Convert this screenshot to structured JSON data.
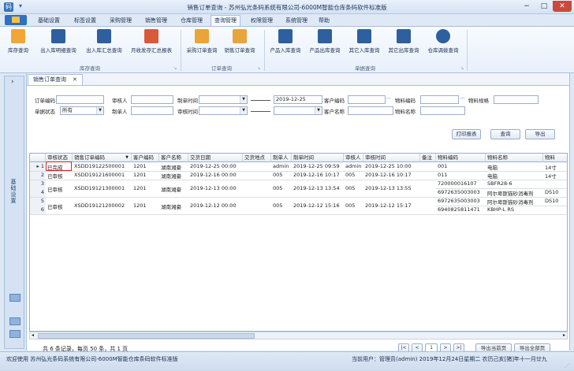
{
  "window": {
    "title": "销售订单查询 - 苏州弘光条码系统有限公司-6000M智能仓库条码软件标准版",
    "min_icon": "−",
    "max_icon": "□",
    "close_icon": "✕"
  },
  "menu": {
    "tabs": [
      "基础设置",
      "标签设置",
      "采购管理",
      "销售管理",
      "仓库管理",
      "查询管理",
      "权限管理",
      "系统管理",
      "帮助"
    ],
    "active_index": 5
  },
  "ribbon": {
    "groups": [
      {
        "label": "库存查询",
        "buttons": [
          "库存查询",
          "出入库明细查询",
          "出入库汇总查询",
          "月收发存汇总报表"
        ]
      },
      {
        "label": "订单查询",
        "buttons": [
          "采购订单查询",
          "销售订单查询"
        ]
      },
      {
        "label": "单据查询",
        "buttons": [
          "产品入库查询",
          "产品出库查询",
          "其它入库查询",
          "其它出库查询",
          "仓库调拨查询"
        ]
      }
    ]
  },
  "sidebar": {
    "label": "基础设置",
    "arrow": "›"
  },
  "doc_tab": {
    "label": "销售订单查询",
    "close": "✕"
  },
  "filters": {
    "order_code_label": "订单编码",
    "reviewer_label": "审核人",
    "made_time_label": "制单时间",
    "date_to_value": "2019-12-25",
    "customer_code_label": "客户编码",
    "material_code_label": "物料编码",
    "material_spec_label": "物料规格",
    "doc_status_label": "单据状态",
    "doc_status_value": "所有",
    "maker_label": "制单人",
    "review_time_label": "审核时间",
    "customer_name_label": "客户名称",
    "material_name_label": "物料名称",
    "ellipsis": "···"
  },
  "actions": {
    "print": "打印报表",
    "query": "查询",
    "export": "导出"
  },
  "grid": {
    "columns": [
      "审核状态",
      "销售订单编码",
      "客户编码",
      "客户名称",
      "交货日期",
      "交货地点",
      "制单人",
      "制单时间",
      "审核人",
      "审核时间",
      "备注",
      "物料编码",
      "物料名称",
      "物料"
    ],
    "rows": [
      {
        "num": "1",
        "status": "已完成",
        "order": "XSDD19122500001",
        "cust_code": "1201",
        "cust_name": "湖南湘豪",
        "delivery": "2019-12-25 00:00",
        "place": "",
        "maker": "admin",
        "made_time": "2019-12-25 09:59",
        "reviewer": "admin",
        "review_time": "2019-12-25 10:00",
        "remark": "",
        "materials": [
          {
            "code": "001",
            "name": "电脑",
            "extra": "14寸"
          }
        ]
      },
      {
        "num": "2",
        "status": "已审核",
        "order": "XSDD19121600001",
        "cust_code": "1201",
        "cust_name": "湖南湘豪",
        "delivery": "2019-12-16 00:00",
        "place": "",
        "maker": "005",
        "made_time": "2019-12-16 10:17",
        "reviewer": "005",
        "review_time": "2019-12-16 10:17",
        "remark": "",
        "materials": [
          {
            "code": "011",
            "name": "电脑",
            "extra": "14寸"
          }
        ]
      },
      {
        "num": "3",
        "status": "已审核",
        "order": "XSDD19121300001",
        "cust_code": "1201",
        "cust_name": "湖南湘豪",
        "delivery": "2019-12-13 00:00",
        "place": "",
        "maker": "005",
        "made_time": "2019-12-13 13:54",
        "reviewer": "005",
        "review_time": "2019-12-13 13:55",
        "remark": "",
        "materials": [
          {
            "code": "720000016107",
            "name": "SBFR28-6",
            "extra": ""
          },
          {
            "code": "6972635003003",
            "name": "阿尔卑斯猫砂消毒剂",
            "extra": "DS10"
          }
        ]
      },
      {
        "num": "5",
        "status": "已审核",
        "order": "XSDD19121200002",
        "cust_code": "1201",
        "cust_name": "湖南湘豪",
        "delivery": "2019-12-12 00:00",
        "place": "",
        "maker": "005",
        "made_time": "2019-12-12 15:16",
        "reviewer": "005",
        "review_time": "2019-12-12 15:17",
        "remark": "",
        "materials": [
          {
            "code": "6972635003003",
            "name": "阿尔卑斯猫砂消毒剂",
            "extra": "DS10"
          },
          {
            "code": "6940825811471",
            "name": "KBHP-L RS",
            "extra": ""
          }
        ]
      }
    ],
    "row_numbers": [
      "1",
      "2",
      "3",
      "4",
      "5",
      "6"
    ]
  },
  "footer": {
    "summary": "共 6 条记录，每页 50 条，共 1 页",
    "page_value": "1",
    "export_page": "导出当前页",
    "export_all": "导出全部页",
    "first": "|<",
    "prev": "<",
    "next": ">",
    "last": ">|"
  },
  "status": {
    "left": "欢迎使用  苏州弘光条码系统有限公司-6000M智能仓库条码软件标准版",
    "right": "当前用户：管理员(admin)     2019年12月24日星期二  农历己亥[猪]年十一月廿九"
  }
}
